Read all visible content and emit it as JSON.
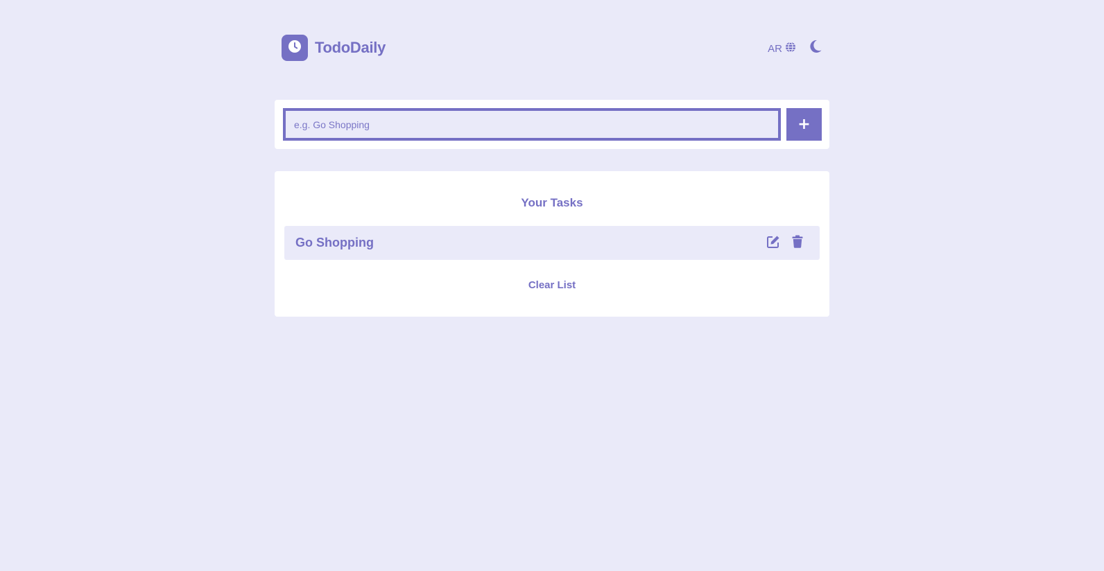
{
  "app": {
    "name": "TodoDaily",
    "logo_icon": "clock-icon",
    "accent_color": "#7570c4",
    "background_color": "#eaeaf9"
  },
  "header": {
    "language_label": "AR",
    "language_icon": "globe-icon",
    "theme_icon": "moon-icon"
  },
  "form": {
    "placeholder": "e.g. Go Shopping",
    "value": "",
    "add_label": "+"
  },
  "list": {
    "title": "Your Tasks",
    "items": [
      {
        "label": "Go Shopping",
        "edit_icon": "edit-icon",
        "delete_icon": "trash-icon"
      }
    ],
    "clear_label": "Clear List"
  }
}
